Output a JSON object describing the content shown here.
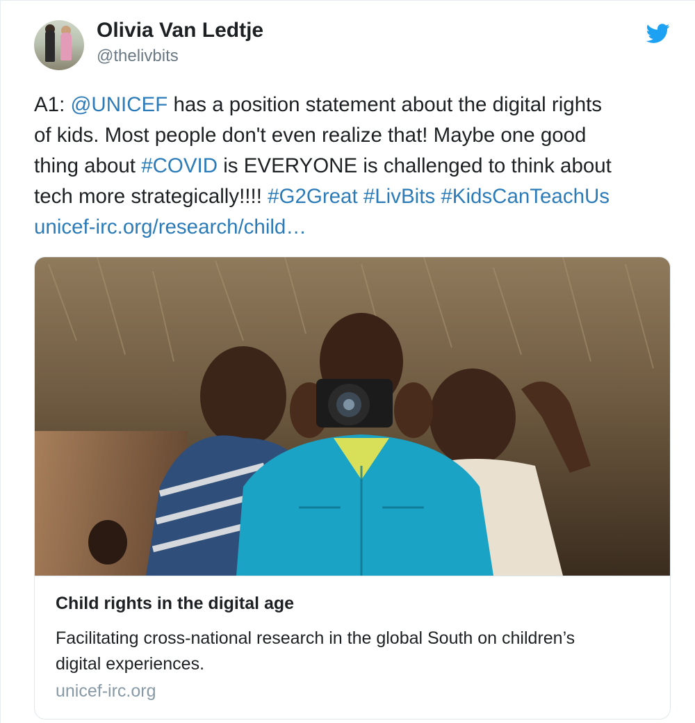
{
  "author": {
    "name": "Olivia Van Ledtje",
    "handle": "@thelivbits"
  },
  "icons": {
    "avatar": "avatar-photo",
    "brand": "twitter-bird-icon",
    "brand_color": "#1da1f2"
  },
  "tweet": {
    "line1": {
      "prefix": "A1: ",
      "mention": "@UNICEF",
      "suffix": " has a position statement about the digital rights"
    },
    "line2": {
      "text": "of kids. Most people don't even realize that! Maybe one good"
    },
    "line3": {
      "prefix": "thing about ",
      "hashtag": "#COVID",
      "suffix": " is EVERYONE is challenged to think about"
    },
    "line4": {
      "prefix": "tech more strategically!!!! ",
      "tag1": "#G2Great",
      "tag2": "#LivBits",
      "tag3": "#KidsCanTeachUs"
    },
    "url": "unicef-irc.org/research/child…",
    "link_color": "#2b7bb9"
  },
  "card": {
    "image": "photo-children-with-camera",
    "title": "Child rights in the digital age",
    "description_line1": "Facilitating cross-national research in the global South on children’s",
    "description_line2": "digital experiences.",
    "domain": "unicef-irc.org"
  }
}
